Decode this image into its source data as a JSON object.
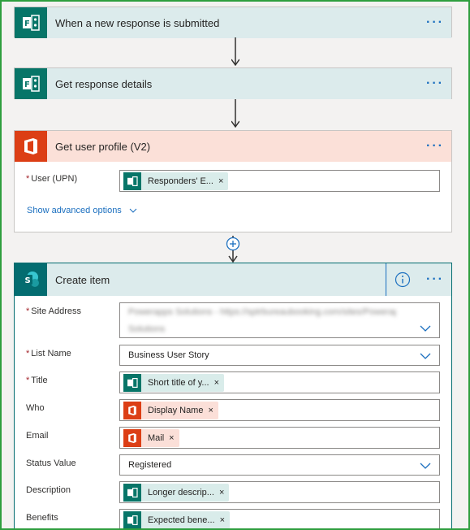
{
  "steps": [
    {
      "title": "When a new response is submitted",
      "icon": "forms-icon",
      "more": "···"
    },
    {
      "title": "Get response details",
      "icon": "forms-icon",
      "more": "···"
    },
    {
      "title": "Get user profile (V2)",
      "icon": "office-icon",
      "more": "···",
      "fields": [
        {
          "label": "User (UPN)",
          "required": "*",
          "token": "Responders' E...",
          "remove": "×"
        }
      ],
      "advanced_link": "Show advanced options"
    }
  ],
  "create_item": {
    "title": "Create item",
    "more": "···",
    "fields": [
      {
        "label": "Site Address",
        "required": "*",
        "value_line1": "Powerapps Solutions - https://sptrbureaubooking.com/sites/Powerapps",
        "value_line2": "Solutions"
      },
      {
        "label": "List Name",
        "required": "*",
        "value": "Business User Story"
      },
      {
        "label": "Title",
        "required": "*",
        "token": "Short title of y...",
        "remove": "×"
      },
      {
        "label": "Who",
        "token": "Display Name",
        "remove": "×"
      },
      {
        "label": "Email",
        "token": "Mail",
        "remove": "×"
      },
      {
        "label": "Status Value",
        "value": "Registered"
      },
      {
        "label": "Description",
        "token": "Longer descrip...",
        "remove": "×"
      },
      {
        "label": "Benefits",
        "token": "Expected bene...",
        "remove": "×"
      }
    ]
  },
  "colors": {
    "forms": "#077568",
    "office": "#dc3e15",
    "sharepoint": "#036c70",
    "link": "#1b6fbf",
    "frame": "#2e9e3e"
  }
}
